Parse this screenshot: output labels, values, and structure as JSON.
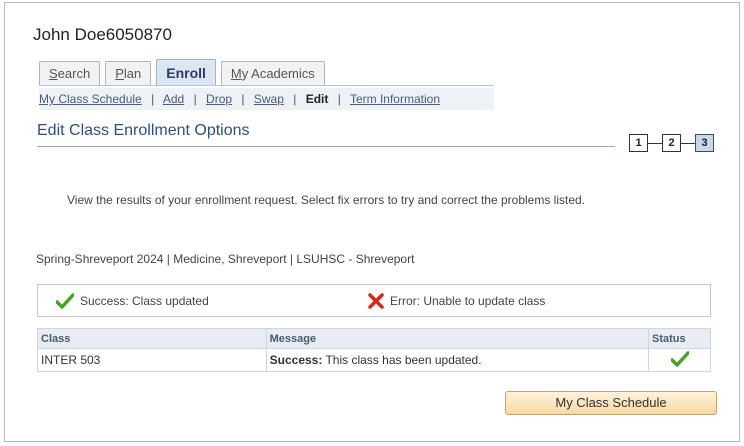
{
  "header": {
    "student_name": "John Doe6050870"
  },
  "tabs": [
    {
      "label": "Search",
      "underline": "S",
      "rest": "earch",
      "active": false
    },
    {
      "label": "Plan",
      "underline": "P",
      "rest": "lan",
      "active": false
    },
    {
      "label": "Enroll",
      "active": true
    },
    {
      "label": "My Academics",
      "underline": "M",
      "rest": "y Academics",
      "active": false
    }
  ],
  "subnav": {
    "my_class_schedule": "My Class Schedule",
    "add": "Add",
    "drop": "Drop",
    "swap": "Swap",
    "edit": "Edit",
    "term_information": "Term Information",
    "separator": "|"
  },
  "page": {
    "title": "Edit Class Enrollment Options",
    "steps": [
      "1",
      "2",
      "3"
    ],
    "current_step": "3",
    "instructions": "View the results of your enrollment request.  Select fix errors to try and correct the problems listed.",
    "term": "Spring-Shreveport 2024 | Medicine, Shreveport | LSUHSC - Shreveport"
  },
  "summary": {
    "success_label": "Success:  Class updated",
    "error_label": "Error: Unable to update class",
    "success_color": "#4aa02c",
    "error_color": "#d9261c"
  },
  "results": {
    "columns": {
      "class": "Class",
      "message": "Message",
      "status": "Status"
    },
    "rows": [
      {
        "class": "INTER  503",
        "message_bold": "Success:",
        "message_rest": " This class has been updated.",
        "status_icon": "checkmark-icon"
      }
    ]
  },
  "buttons": {
    "my_class_schedule": "My Class Schedule"
  }
}
